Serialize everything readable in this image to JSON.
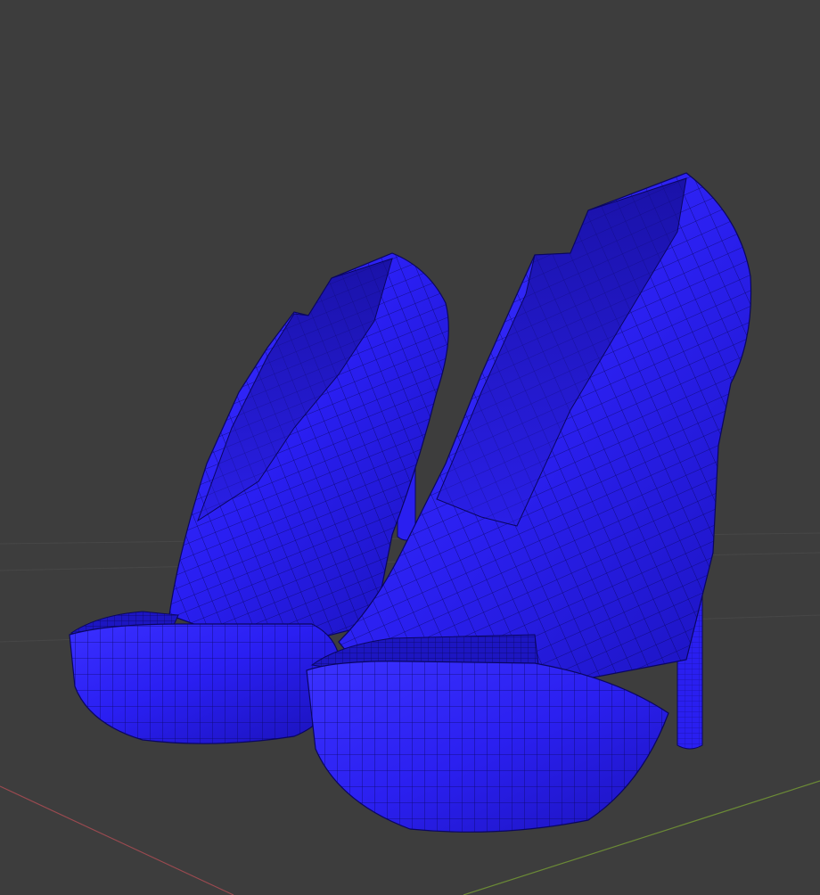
{
  "viewport": {
    "background_color": "#3d3d3d",
    "grid_line_color": "#484848",
    "x_axis_color": "#9a4a50",
    "y_axis_color": "#6b8a36"
  },
  "scene": {
    "objects": [
      {
        "name": "high-heel-shoe-left",
        "material_color": "#2b1ff0",
        "display": "solid-wireframe"
      },
      {
        "name": "high-heel-shoe-right",
        "material_color": "#2b1ff0",
        "display": "solid-wireframe"
      }
    ],
    "wire_color": "#0a0660"
  }
}
